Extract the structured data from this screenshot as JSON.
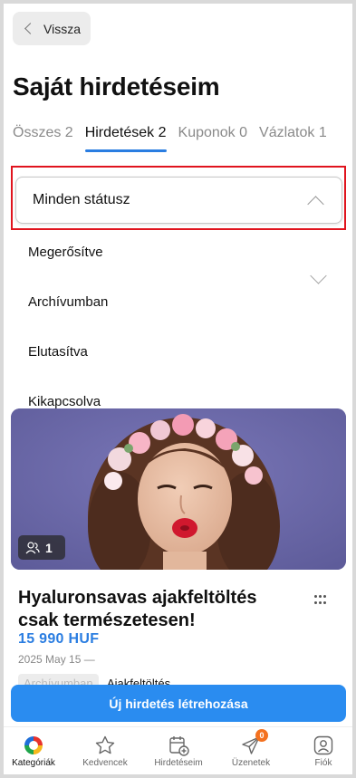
{
  "header": {
    "back_label": "Vissza",
    "title": "Saját hirdetéseim"
  },
  "tabs": [
    {
      "label": "Összes 2",
      "active": false
    },
    {
      "label": "Hirdetések 2",
      "active": true
    },
    {
      "label": "Kuponok 0",
      "active": false
    },
    {
      "label": "Vázlatok 1",
      "active": false
    }
  ],
  "status_filter": {
    "selected": "Minden státusz",
    "options": [
      "Megerősítve",
      "Archívumban",
      "Elutasítva",
      "Kikapcsolva"
    ]
  },
  "listing": {
    "photo_count": "1",
    "title": "Hyaluronsavas ajakfeltöltés csak természetesen!",
    "price": "15 990 HUF",
    "date": "2025 May 15 —",
    "status": "Archívumban",
    "category": "Ajakfeltöltés"
  },
  "create_button": "Új hirdetés létrehozása",
  "bottom_nav": [
    {
      "label": "Kategóriák",
      "icon": "category-logo-icon",
      "active": true
    },
    {
      "label": "Kedvencek",
      "icon": "star-icon",
      "active": false
    },
    {
      "label": "Hirdetéseim",
      "icon": "calendar-add-icon",
      "active": false
    },
    {
      "label": "Üzenetek",
      "icon": "paper-plane-icon",
      "active": false,
      "badge": "0"
    },
    {
      "label": "Fiók",
      "icon": "user-icon",
      "active": false
    }
  ],
  "colors": {
    "accent": "#2a7de1",
    "button": "#2a8cf0",
    "highlight_outline": "#e0141e",
    "badge": "#f4711f"
  }
}
